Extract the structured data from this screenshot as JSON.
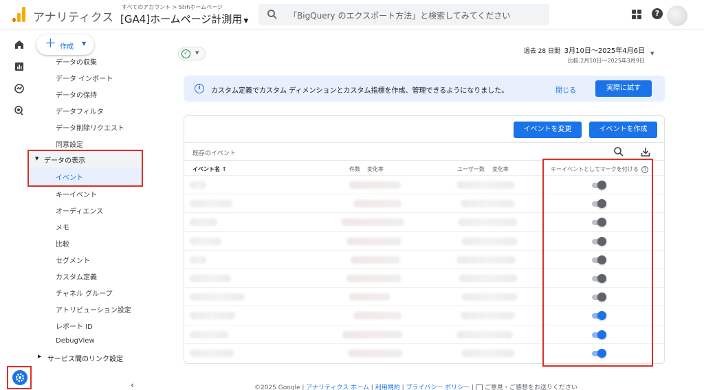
{
  "topbar": {
    "brand": "アナリティクス",
    "account_breadcrumb": "すべてのアカウント > Strhホームページ",
    "property_name": "[GA4]ホームページ計測用",
    "search_placeholder": "「BigQuery のエクスポート方法」と検索してみてください"
  },
  "sidebar": {
    "create_label": "作成",
    "items_top": [
      "データの収集",
      "データ インポート",
      "データの保持",
      "データフィルタ",
      "データ削除リクエスト",
      "同意設定"
    ],
    "section_data_display": "データの表示",
    "selected_item": "イベント",
    "items_bottom": [
      "キーイベント",
      "オーディエンス",
      "メモ",
      "比較",
      "セグメント",
      "カスタム定義",
      "チャネル グループ",
      "アトリビューション設定",
      "レポート ID",
      "DebugView"
    ],
    "section_service_links": "サービス間のリンク設定"
  },
  "date_range": {
    "label": "過去 28 日間",
    "range": "3月10日～2025年4月6日",
    "compare": "比較:2月10日～2025年3月9日"
  },
  "banner": {
    "message": "カスタム定義でカスタム ディメンションとカスタム指標を作成、管理できるようになりました。",
    "close_label": "閉じる",
    "try_label": "実際に試す"
  },
  "events_card": {
    "modify_button": "イベントを変更",
    "create_button": "イベントを作成",
    "subtitle": "既存のイベント",
    "columns": {
      "event_name": "イベント名 ↑",
      "count": "件数",
      "count_change": "変化率",
      "users": "ユーザー数",
      "users_change": "変化率",
      "mark_key_event": "キーイベントとしてマークを付ける"
    },
    "rows": [
      {
        "key_event": false
      },
      {
        "key_event": false
      },
      {
        "key_event": false
      },
      {
        "key_event": false
      },
      {
        "key_event": false
      },
      {
        "key_event": false
      },
      {
        "key_event": false
      },
      {
        "key_event": true
      },
      {
        "key_event": true
      },
      {
        "key_event": true
      }
    ]
  },
  "footer": {
    "copyright": "©2025 Google |",
    "link_home": "アナリティクス ホーム",
    "sep1": "|",
    "link_terms": "利用規約",
    "sep2": "|",
    "link_privacy": "プライバシー ポリシー",
    "sep3": "|",
    "feedback": "ご意見・ご感想をお送りください"
  },
  "colors": {
    "accent": "#1a73e8",
    "highlight_border": "#d93025",
    "logo_orange": "#f9ab00",
    "logo_dark": "#e37400"
  }
}
